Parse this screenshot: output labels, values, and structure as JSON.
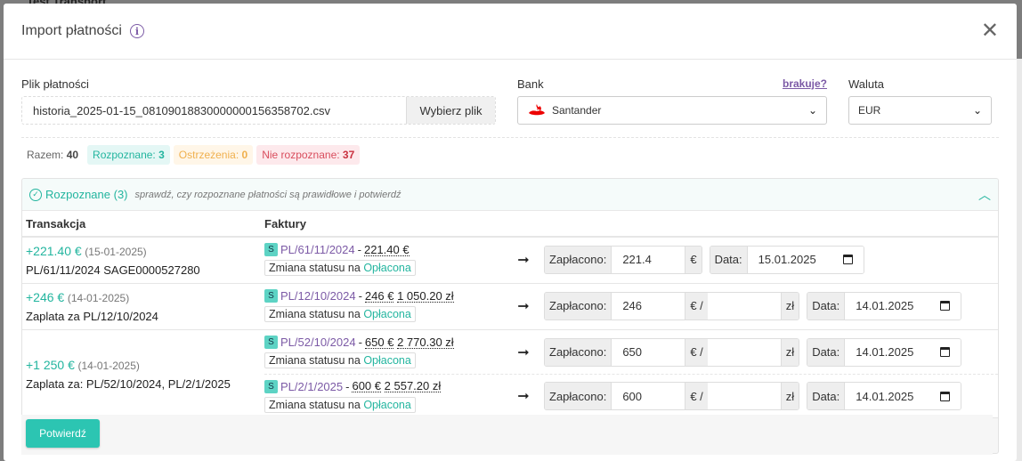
{
  "background": {
    "title": "Test Transport"
  },
  "modal": {
    "title": "Import płatności",
    "info_icon": "i"
  },
  "file": {
    "label": "Plik płatności",
    "filename": "historia_2025-01-15_08109018830000000156358702.csv",
    "choose_button": "Wybierz plik"
  },
  "bank": {
    "label": "Bank",
    "missing_link": "brakuje?",
    "selected": "Santander",
    "logo_color": "#ec0000"
  },
  "currency": {
    "label": "Waluta",
    "selected": "EUR"
  },
  "counters": {
    "total_label": "Razem:",
    "total_value": "40",
    "recognized_label": "Rozpoznane:",
    "recognized_value": "3",
    "warnings_label": "Ostrzeżenia:",
    "warnings_value": "0",
    "unrecognized_label": "Nie rozpoznane:",
    "unrecognized_value": "37"
  },
  "section": {
    "title": "Rozpoznane (3)",
    "hint": "sprawdź, czy rozpoznane płatności są prawidłowe i potwierdź"
  },
  "table": {
    "col_transaction": "Transakcja",
    "col_invoices": "Faktury",
    "paid_label": "Zapłacono:",
    "date_label": "Data:",
    "status_prefix": "Zmiana statusu na",
    "status_value": "Opłacona",
    "arrow": "➞",
    "s_badge": "S",
    "euro": "€",
    "euro_slash": "€ /",
    "pln": "zł",
    "dash": "-",
    "rows": [
      {
        "amount": "+221.40 €",
        "date": "(15-01-2025)",
        "desc": "PL/61/11/2024 SAGE0000527280",
        "invoices": [
          {
            "no": "PL/61/11/2024",
            "value": "221.40 €",
            "pln": "",
            "paid": "221.4",
            "pln_input": "",
            "pay_date": "15.01.2025"
          }
        ]
      },
      {
        "amount": "+246 €",
        "date": "(14-01-2025)",
        "desc": "Zaplata za PL/12/10/2024",
        "invoices": [
          {
            "no": "PL/12/10/2024",
            "value": "246 €",
            "pln": "1 050.20 zł",
            "paid": "246",
            "pln_input": "",
            "pay_date": "14.01.2025"
          }
        ]
      },
      {
        "amount": "+1 250 €",
        "date": "(14-01-2025)",
        "desc": "Zaplata za: PL/52/10/2024, PL/2/1/2025",
        "invoices": [
          {
            "no": "PL/52/10/2024",
            "value": "650 €",
            "pln": "2 770.30 zł",
            "paid": "650",
            "pln_input": "",
            "pay_date": "14.01.2025"
          },
          {
            "no": "PL/2/1/2025",
            "value": "600 €",
            "pln": "2 557.20 zł",
            "paid": "600",
            "pln_input": "",
            "pay_date": "14.01.2025"
          }
        ]
      }
    ]
  },
  "footer": {
    "confirm_button": "Potwierdź"
  }
}
